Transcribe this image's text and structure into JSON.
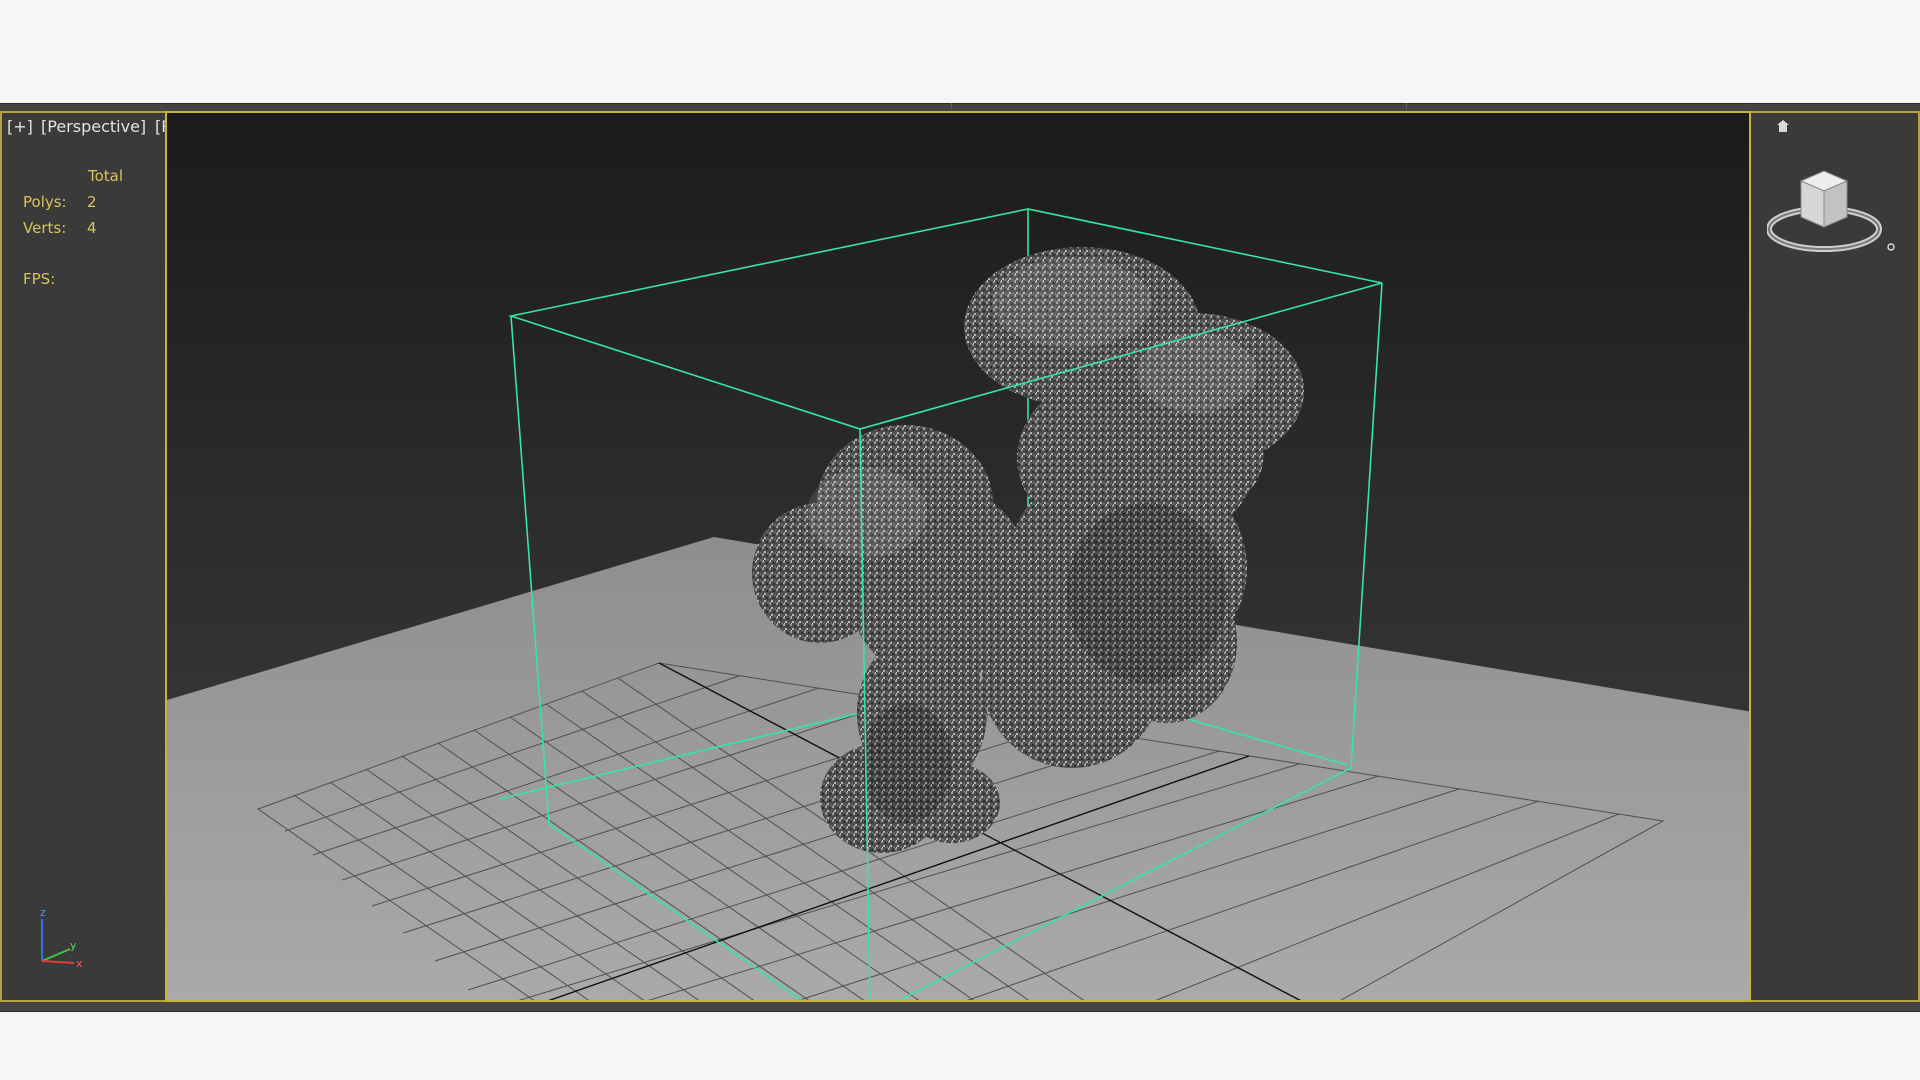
{
  "viewport_labels": {
    "plus": "[+]",
    "view": "[Perspective]",
    "shading": "[Realistic]"
  },
  "stats": {
    "header": "Total",
    "polys_label": "Polys:",
    "polys_value": "2",
    "verts_label": "Verts:",
    "verts_value": "4",
    "fps_label": "FPS:",
    "fps_value": ""
  },
  "axis_tripod": {
    "z": "z",
    "y": "y",
    "x": "x"
  },
  "colors": {
    "active_border": "#c8b23c",
    "bounding_box": "#35e6a0",
    "stats_text": "#d8c25a",
    "panel_bg": "#3a3a3a",
    "ground": "#a2a2a2"
  },
  "icons": {
    "home": "home-icon",
    "viewcube": "viewcube-icon"
  }
}
